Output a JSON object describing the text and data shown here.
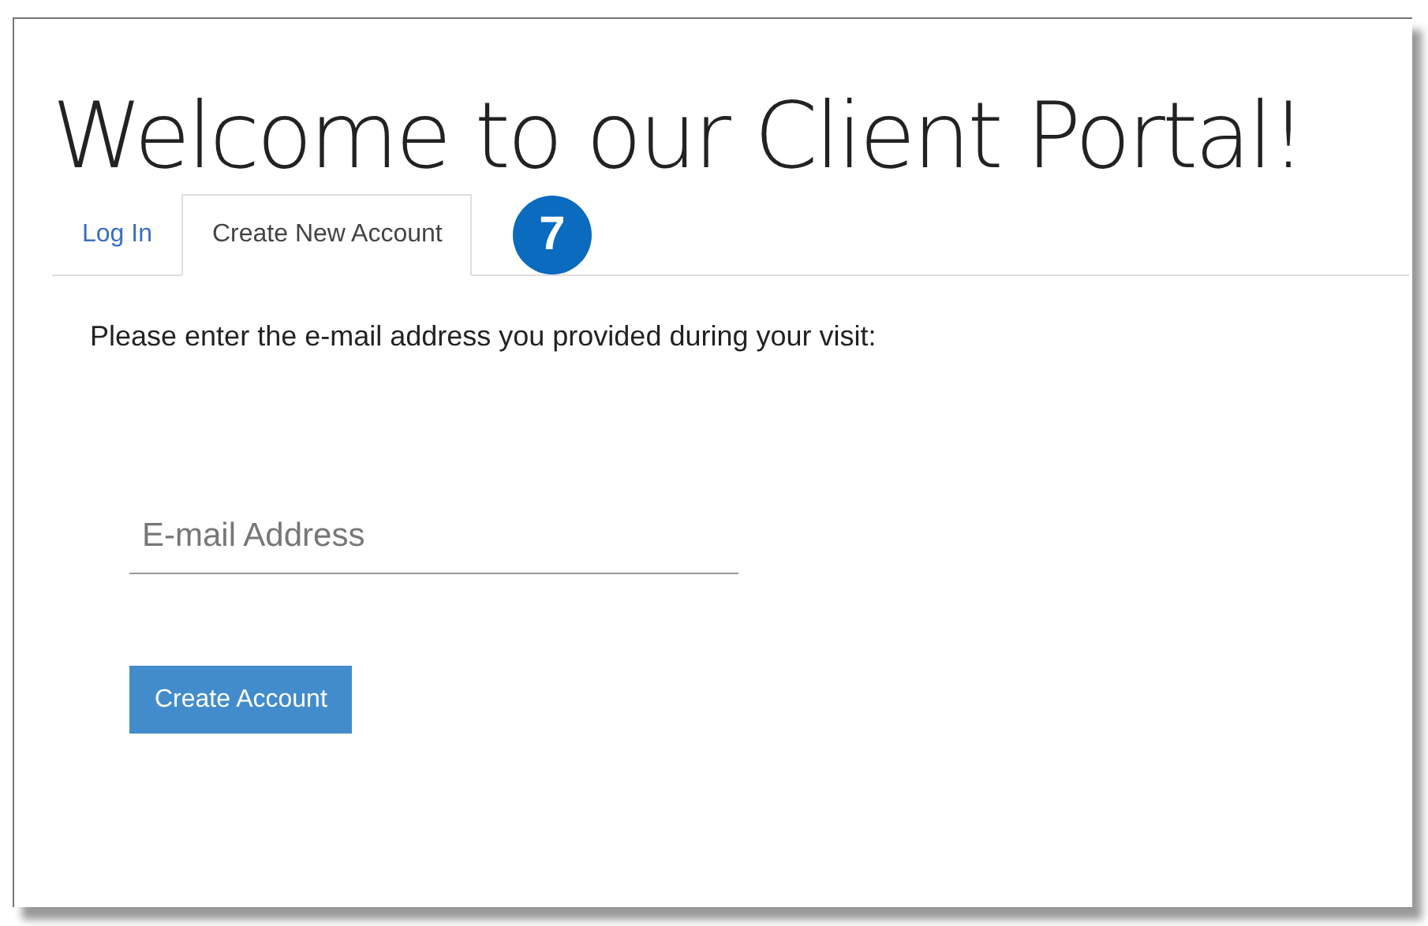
{
  "title": "Welcome to our Client Portal!",
  "tabs": [
    {
      "label": "Log In",
      "selected": false
    },
    {
      "label": "Create New Account",
      "selected": true
    }
  ],
  "step_badge": "7",
  "instruction": "Please enter the e-mail address you provided during your visit:",
  "email_field": {
    "placeholder": "E-mail Address"
  },
  "buttons": [
    "Create Account"
  ]
}
